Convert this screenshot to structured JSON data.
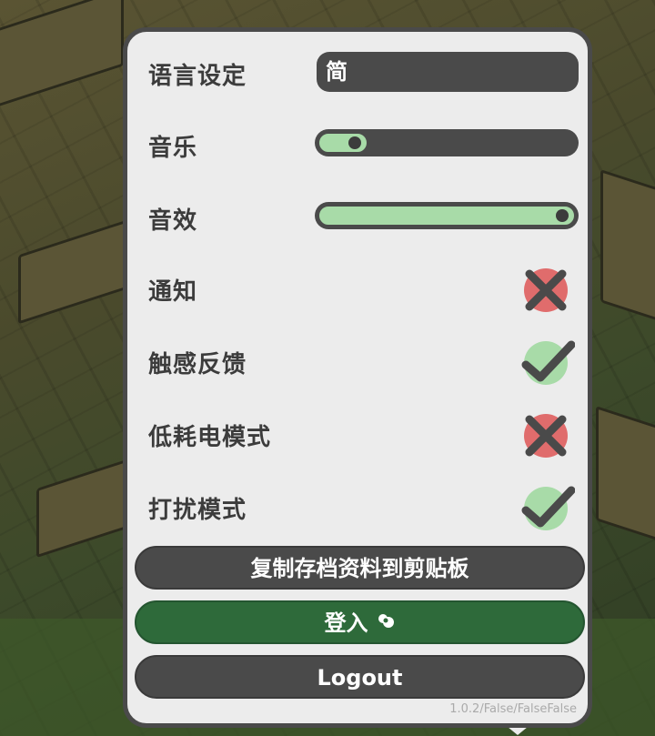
{
  "settings": {
    "language": {
      "label": "语言设定",
      "value": "简"
    },
    "music": {
      "label": "音乐",
      "level": 0.15
    },
    "sound_effects": {
      "label": "音效",
      "level": 1.0
    },
    "notifications": {
      "label": "通知",
      "enabled": false
    },
    "haptics": {
      "label": "触感反馈",
      "enabled": true
    },
    "low_power": {
      "label": "低耗电模式",
      "enabled": false
    },
    "do_not_disturb": {
      "label": "打扰模式",
      "enabled": true
    }
  },
  "buttons": {
    "copy_save": "复制存档资料到剪贴板",
    "login": "登入",
    "logout": "Logout"
  },
  "version": "1.0.2/False/FalseFalse",
  "colors": {
    "on": "#a8dba8",
    "off": "#e06c6c",
    "dark": "#4a4a4a",
    "login_green": "#2e6a3a",
    "panel": "#ececec"
  },
  "icons": {
    "toggle_on": "check-icon",
    "toggle_off": "cross-icon",
    "login": "login-swirl-icon"
  }
}
